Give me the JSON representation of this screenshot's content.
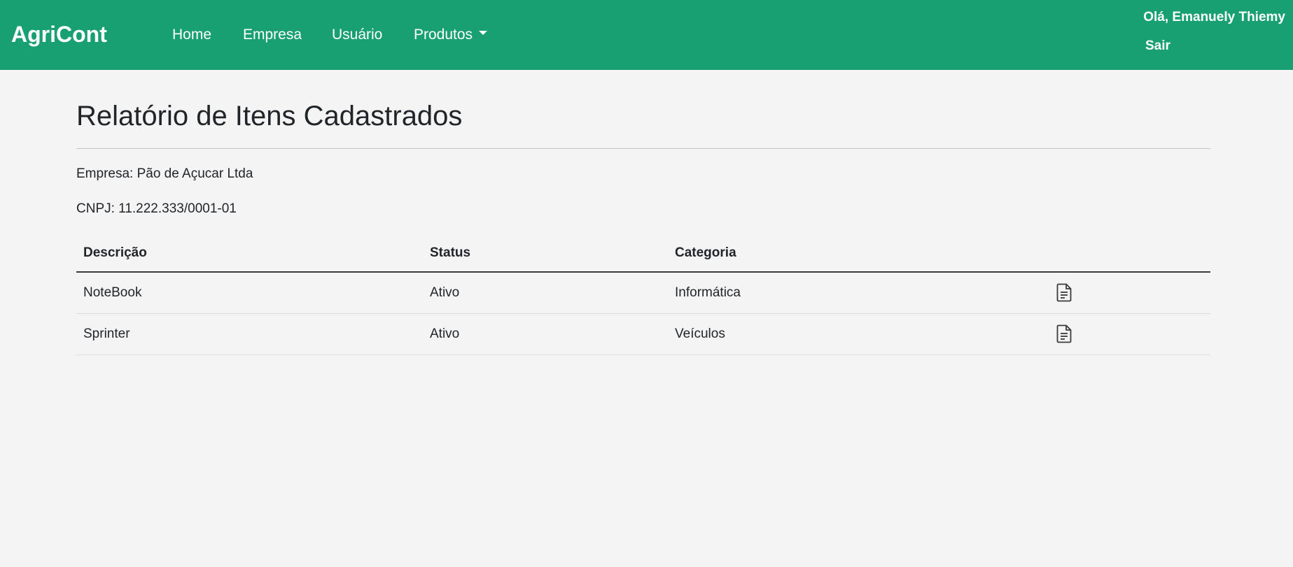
{
  "navbar": {
    "brand": "AgriCont",
    "links": [
      {
        "label": "Home"
      },
      {
        "label": "Empresa"
      },
      {
        "label": "Usuário"
      },
      {
        "label": "Produtos"
      }
    ],
    "greeting": "Olá, Emanuely Thiemy",
    "logout": "Sair",
    "color": "#19a072"
  },
  "main": {
    "title": "Relatório de Itens Cadastrados",
    "company": "Empresa: Pão de Açucar Ltda",
    "cnpj": "CNPJ: 11.222.333/0001-01",
    "table": {
      "headers": [
        "Descrição",
        "Status",
        "Categoria",
        ""
      ],
      "rows": [
        {
          "description": "NoteBook",
          "status": "Ativo",
          "category": "Informática",
          "action_icon": "document-icon"
        },
        {
          "description": "Sprinter",
          "status": "Ativo",
          "category": "Veículos",
          "action_icon": "document-icon"
        }
      ]
    }
  }
}
